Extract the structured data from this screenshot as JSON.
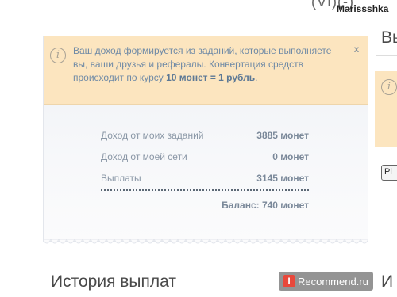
{
  "header": {
    "top_cut_text": "(VI)(-)",
    "username": "Marissshka"
  },
  "notice": {
    "icon": "info-icon",
    "text_part1": "Ваш доход формируется из заданий, которые выполняете вы, ваши друзья и рефералы. Конвертация средств происходит по курсу ",
    "rate_bold": "10 монет = 1 рубль",
    "text_end": ".",
    "close_label": "x"
  },
  "stats": {
    "rows": [
      {
        "label": "Доход от моих заданий",
        "value": "3885 монет"
      },
      {
        "label": "Доход от моей сети",
        "value": "0 монет"
      },
      {
        "label": "Выплаты",
        "value": "3145 монет"
      }
    ],
    "balance": "Баланс: 740 монет"
  },
  "history": {
    "title": "История выплат"
  },
  "right_column": {
    "heading": "Вы",
    "button_label": "Pl",
    "bottom_heading": "И"
  },
  "watermark": {
    "logo_letter": "I",
    "text": "Recommend.ru"
  }
}
